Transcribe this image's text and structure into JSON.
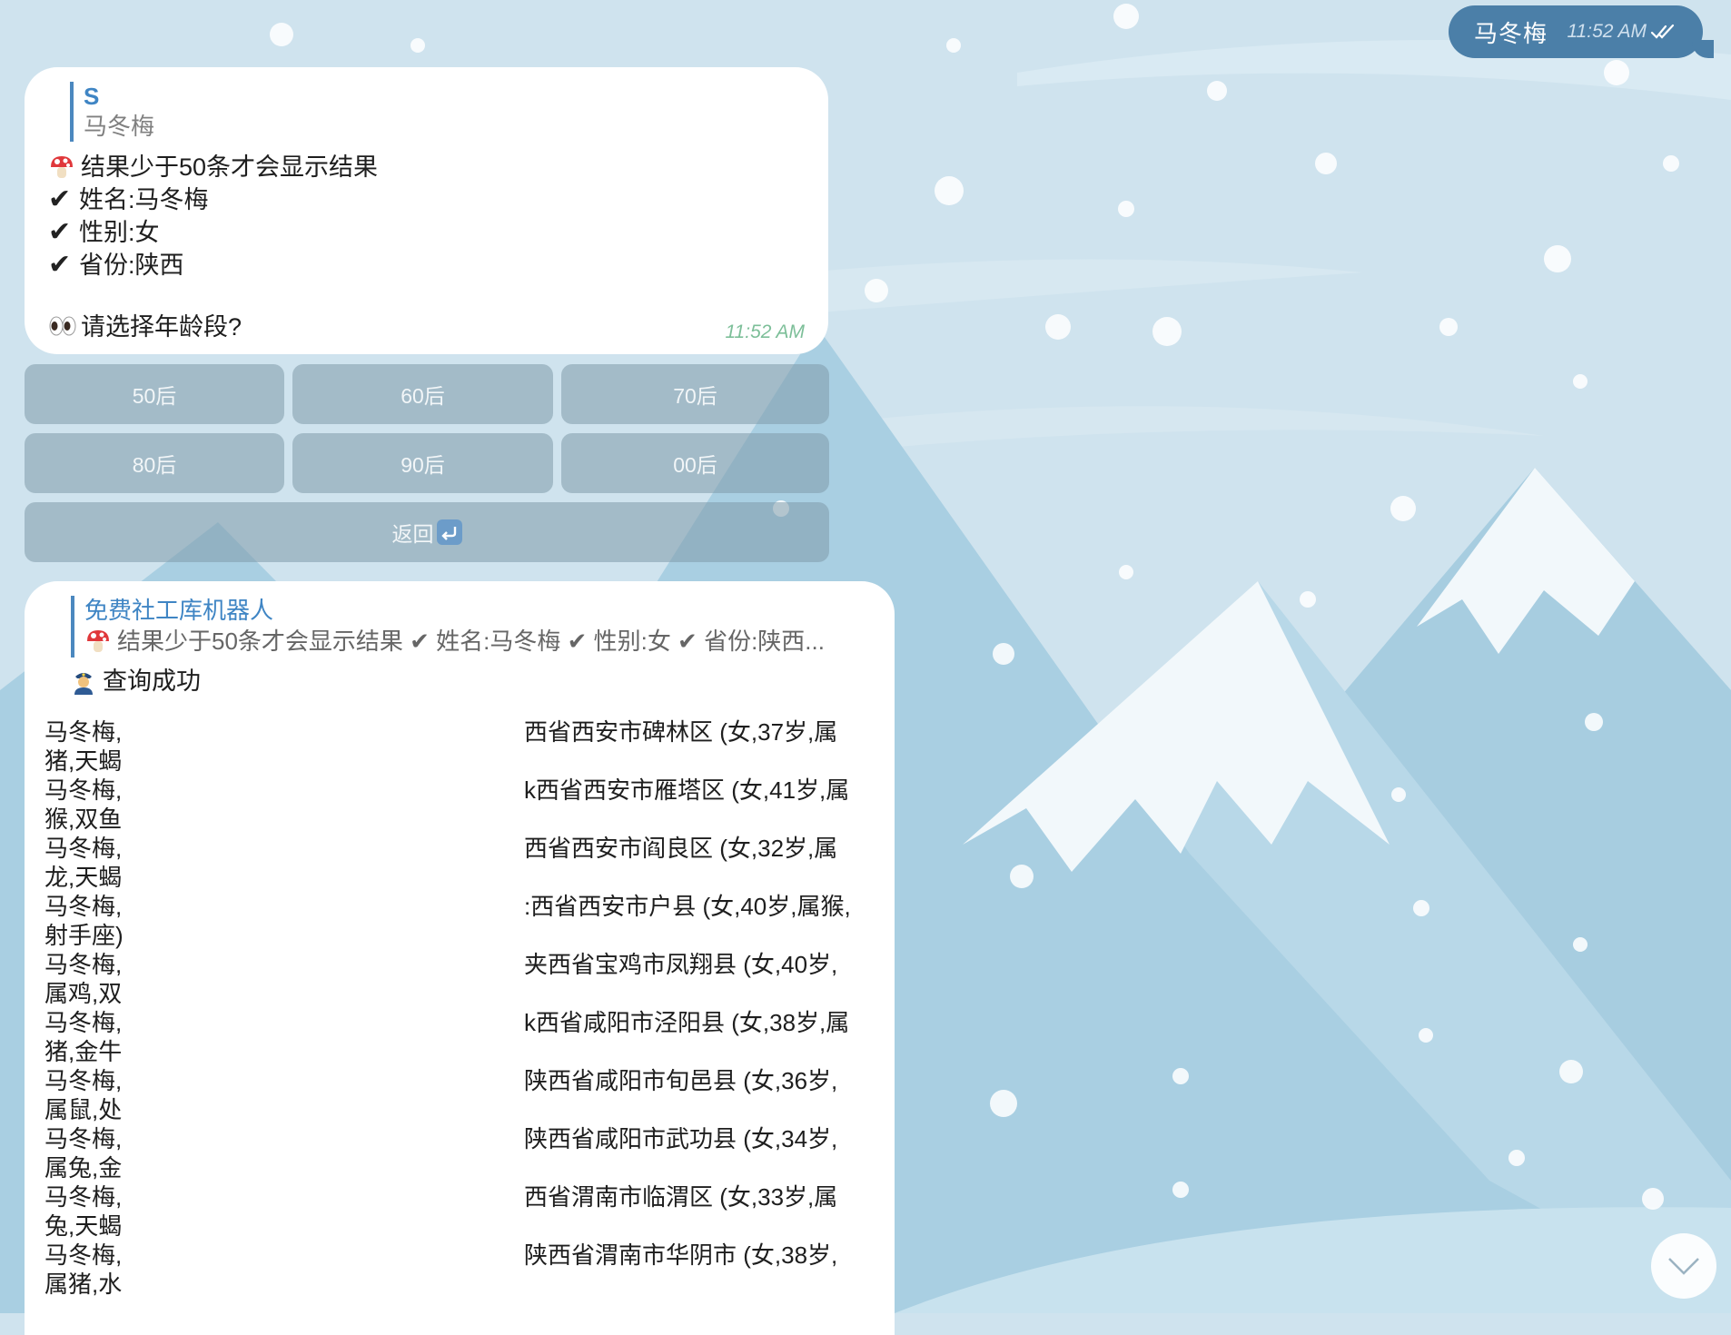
{
  "outgoing": {
    "text": "马冬梅",
    "time": "11:52 AM",
    "status_icon": "double-check-icon"
  },
  "bot_reply_1": {
    "reply_to": {
      "name": "S",
      "text": "马冬梅"
    },
    "lines": [
      {
        "icon": "mushroom-icon",
        "text": "结果少于50条才会显示结果"
      },
      {
        "icon": "check-icon",
        "text": "姓名:马冬梅"
      },
      {
        "icon": "check-icon",
        "text": "性别:女"
      },
      {
        "icon": "check-icon",
        "text": "省份:陕西"
      }
    ],
    "question": {
      "icon": "eyes-icon",
      "text": "请选择年龄段?"
    },
    "time": "11:52 AM"
  },
  "keyboard": {
    "rows": [
      [
        "50后",
        "60后",
        "70后"
      ],
      [
        "80后",
        "90后",
        "00后"
      ]
    ],
    "back_label": "返回",
    "back_icon": "return-arrow-icon"
  },
  "bot_reply_2": {
    "reply_to": {
      "name": "免费社工库机器人",
      "text": "结果少于50条才会显示结果 ✔ 姓名:马冬梅 ✔ 性别:女 ✔ 省份:陕西..."
    },
    "status": {
      "icon": "police-officer-icon",
      "text": "查询成功"
    },
    "results": [
      {
        "left1": "马冬梅,",
        "left2": "猪,天蝎",
        "right": "西省西安市碑林区 (女,37岁,属"
      },
      {
        "left1": "马冬梅,",
        "left2": "猴,双鱼",
        "right": "k西省西安市雁塔区 (女,41岁,属"
      },
      {
        "left1": "马冬梅,",
        "left2": "龙,天蝎",
        "right": "西省西安市阎良区 (女,32岁,属"
      },
      {
        "left1": "马冬梅,",
        "left2": "射手座)",
        "right": ":西省西安市户县 (女,40岁,属猴,"
      },
      {
        "left1": "马冬梅,",
        "left2": "属鸡,双",
        "right": "夹西省宝鸡市凤翔县 (女,40岁,"
      },
      {
        "left1": "马冬梅,",
        "left2": "猪,金牛",
        "right": "k西省咸阳市泾阳县 (女,38岁,属"
      },
      {
        "left1": "马冬梅,",
        "left2": "属鼠,处",
        "right": "陕西省咸阳市旬邑县 (女,36岁,"
      },
      {
        "left1": "马冬梅,",
        "left2": "属兔,金",
        "right": "陕西省咸阳市武功县 (女,34岁,"
      },
      {
        "left1": "马冬梅,",
        "left2": "兔,天蝎",
        "right": "西省渭南市临渭区 (女,33岁,属"
      },
      {
        "left1": "马冬梅,",
        "left2": "属猪,水",
        "right": "陕西省渭南市华阴市 (女,38岁,"
      }
    ]
  },
  "scroll_button": {
    "icon": "chevron-down-icon"
  },
  "colors": {
    "accent": "#4b7fa8",
    "link": "#3f85c4",
    "time_green": "#7dbf99"
  }
}
